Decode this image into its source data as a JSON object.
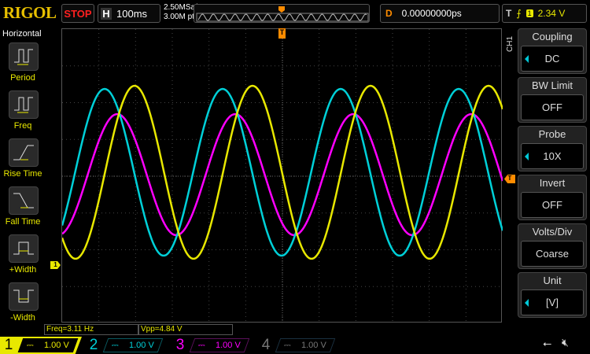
{
  "header": {
    "logo": "RIGOL",
    "run_state": "STOP",
    "timebase_label": "H",
    "timebase": "100ms",
    "sample_rate": "2.50MSa/s",
    "memory_depth": "3.00M pts",
    "delay_label": "D",
    "delay": "0.00000000ps",
    "trigger_label": "T",
    "trigger_channel": "1",
    "trigger_level": "2.34 V"
  },
  "left_menu": {
    "title": "Horizontal",
    "items": [
      {
        "label": "Period"
      },
      {
        "label": "Freq"
      },
      {
        "label": "Rise Time"
      },
      {
        "label": "Fall Time"
      },
      {
        "label": "+Width"
      },
      {
        "label": "-Width"
      }
    ]
  },
  "right_menu": {
    "channel": "CH1",
    "items": [
      {
        "label": "Coupling",
        "value": "DC"
      },
      {
        "label": "BW Limit",
        "value": "OFF"
      },
      {
        "label": "Probe",
        "value": "10X"
      },
      {
        "label": "Invert",
        "value": "OFF"
      },
      {
        "label": "Volts/Div",
        "value": "Coarse"
      },
      {
        "label": "Unit",
        "value": "[V]"
      }
    ]
  },
  "measurements": {
    "freq": "Freq=3.11 Hz",
    "vpp": "Vpp=4.84 V"
  },
  "channels": [
    {
      "num": "1",
      "scale": "1.00 V",
      "color": "#e8e800"
    },
    {
      "num": "2",
      "scale": "1.00 V",
      "color": "#00d0d8"
    },
    {
      "num": "3",
      "scale": "1.00 V",
      "color": "#ff00ff"
    },
    {
      "num": "4",
      "scale": "1.00 V",
      "color": "#777777"
    }
  ],
  "markers": {
    "trigger": "T",
    "ch1_ground": "1"
  }
}
